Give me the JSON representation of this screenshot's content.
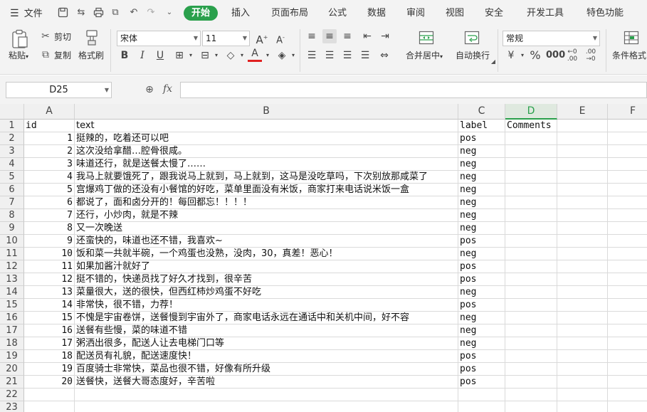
{
  "menubar": {
    "file_label": "文件",
    "tabs": [
      "开始",
      "插入",
      "页面布局",
      "公式",
      "数据",
      "审阅",
      "视图",
      "安全",
      "开发工具",
      "特色功能"
    ]
  },
  "ribbon": {
    "paste": "粘贴",
    "cut": "剪切",
    "copy": "复制",
    "format_painter": "格式刷",
    "font_name": "宋体",
    "font_size": "11",
    "merge_center": "合并居中",
    "wrap_text": "自动换行",
    "number_format": "常规",
    "conditional_format": "条件格式"
  },
  "formula_bar": {
    "name_box": "D25",
    "fx": "fx",
    "formula": ""
  },
  "sheet": {
    "columns": [
      "A",
      "B",
      "C",
      "D",
      "E",
      "F"
    ],
    "selected_column": "D",
    "row_numbers": [
      "1",
      "2",
      "3",
      "4",
      "5",
      "6",
      "7",
      "8",
      "9",
      "10",
      "11",
      "12",
      "13",
      "14",
      "15",
      "16",
      "17",
      "18",
      "19",
      "20",
      "21",
      "22",
      "23"
    ],
    "headers": {
      "a": "id",
      "b": "text",
      "c": "label",
      "d": "Comments"
    },
    "rows": [
      {
        "id": "1",
        "text": "挺辣的，吃着还可以吧",
        "label": "pos"
      },
      {
        "id": "2",
        "text": "这次没给拿醋…腔骨很咸。",
        "label": "neg"
      },
      {
        "id": "3",
        "text": "味道还行，就是送餐太慢了……",
        "label": "neg"
      },
      {
        "id": "4",
        "text": "我马上就要饿死了，跟我说马上就到，马上就到，这马是没吃草吗，下次别放那咸菜了",
        "label": "neg"
      },
      {
        "id": "5",
        "text": "宫爆鸡丁做的还没有小餐馆的好吃，菜单里面没有米饭，商家打来电话说米饭一盒",
        "label": "neg"
      },
      {
        "id": "6",
        "text": "都说了，面和卤分开的！每回都忘！！！！",
        "label": "neg"
      },
      {
        "id": "7",
        "text": "还行，小炒肉，就是不辣",
        "label": "neg"
      },
      {
        "id": "8",
        "text": "又一次晚送",
        "label": "neg"
      },
      {
        "id": "9",
        "text": "还蛮快的，味道也还不错，我喜欢~",
        "label": "pos"
      },
      {
        "id": "10",
        "text": "饭和菜一共就半碗，一个鸡蛋也没熟，没肉，30，真差！恶心！",
        "label": "neg"
      },
      {
        "id": "11",
        "text": "如果加酱汁就好了",
        "label": "pos"
      },
      {
        "id": "12",
        "text": "挺不错的，快递员找了好久才找到，很辛苦",
        "label": "pos"
      },
      {
        "id": "13",
        "text": "菜量很大，送的很快，但西红柿炒鸡蛋不好吃",
        "label": "neg"
      },
      {
        "id": "14",
        "text": "非常快，很不错，力荐！",
        "label": "pos"
      },
      {
        "id": "15",
        "text": "不愧是宇宙卷饼，送餐慢到宇宙外了，商家电话永远在通话中和关机中间，好不容",
        "label": "neg"
      },
      {
        "id": "16",
        "text": "送餐有些慢，菜的味道不错",
        "label": "neg"
      },
      {
        "id": "17",
        "text": "粥洒出很多，配送人让去电梯门口等",
        "label": "neg"
      },
      {
        "id": "18",
        "text": "配送员有礼貌，配送速度快！",
        "label": "pos"
      },
      {
        "id": "19",
        "text": "百度骑士非常快，菜品也很不错，好像有所升级",
        "label": "pos"
      },
      {
        "id": "20",
        "text": "送餐快，送餐大哥态度好，辛苦啦",
        "label": "pos"
      }
    ]
  },
  "colors": {
    "accent": "#2aa04c",
    "font_color_bar": "#e02020"
  },
  "icons": [
    "menu-icon",
    "save-icon",
    "print-icon",
    "undo-icon",
    "redo-icon",
    "zoom-icon",
    "paste-icon",
    "cut-icon",
    "copy-icon",
    "brush-icon"
  ]
}
